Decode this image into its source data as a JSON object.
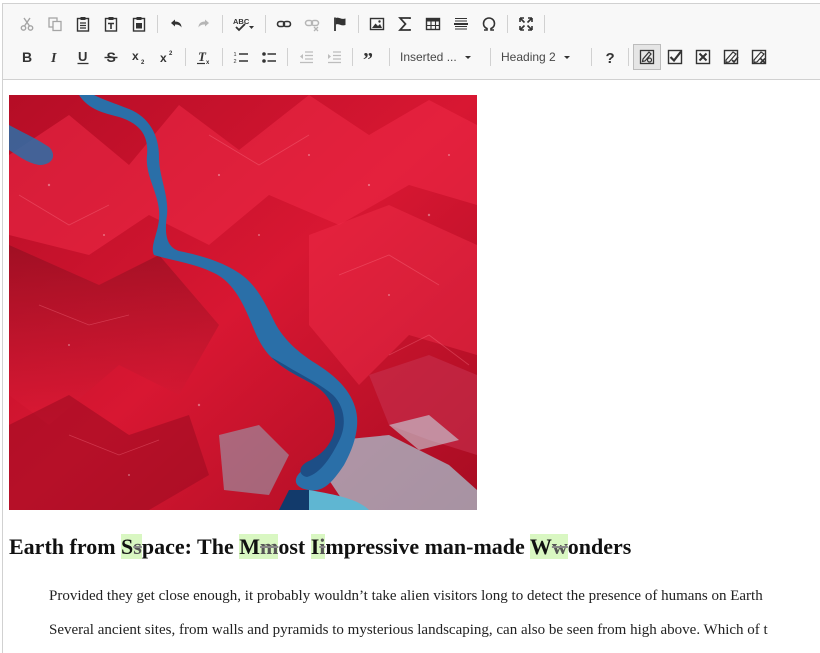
{
  "toolbar": {
    "format_combo": "Inserted ...",
    "heading_combo": "Heading 2"
  },
  "article": {
    "title": [
      {
        "t": "Earth from ",
        "k": "n"
      },
      {
        "t": "S",
        "k": "ins"
      },
      {
        "t": "s",
        "k": "del"
      },
      {
        "t": "pace: The ",
        "k": "n"
      },
      {
        "t": "M",
        "k": "ins"
      },
      {
        "t": "m",
        "k": "del"
      },
      {
        "t": "ost ",
        "k": "n"
      },
      {
        "t": "I",
        "k": "ins"
      },
      {
        "t": "i",
        "k": "del"
      },
      {
        "t": "mpressive man-made ",
        "k": "n"
      },
      {
        "t": "W",
        "k": "ins"
      },
      {
        "t": "w",
        "k": "del"
      },
      {
        "t": "onders",
        "k": "n"
      }
    ],
    "para1": "Provided they get close enough, it probably wouldn’t take alien visitors long to detect the presence of humans on Earth",
    "para2": "Several ancient sites, from walls and pyramids to mysterious landscaping, can also be seen from high above. Which of t"
  },
  "colors": {
    "toolbar_bg": "#f8f8f8",
    "track_insert_bg": "#d9f7c2",
    "satellite_vegetation": "#c5102a",
    "satellite_water": "#2a6fa8"
  }
}
